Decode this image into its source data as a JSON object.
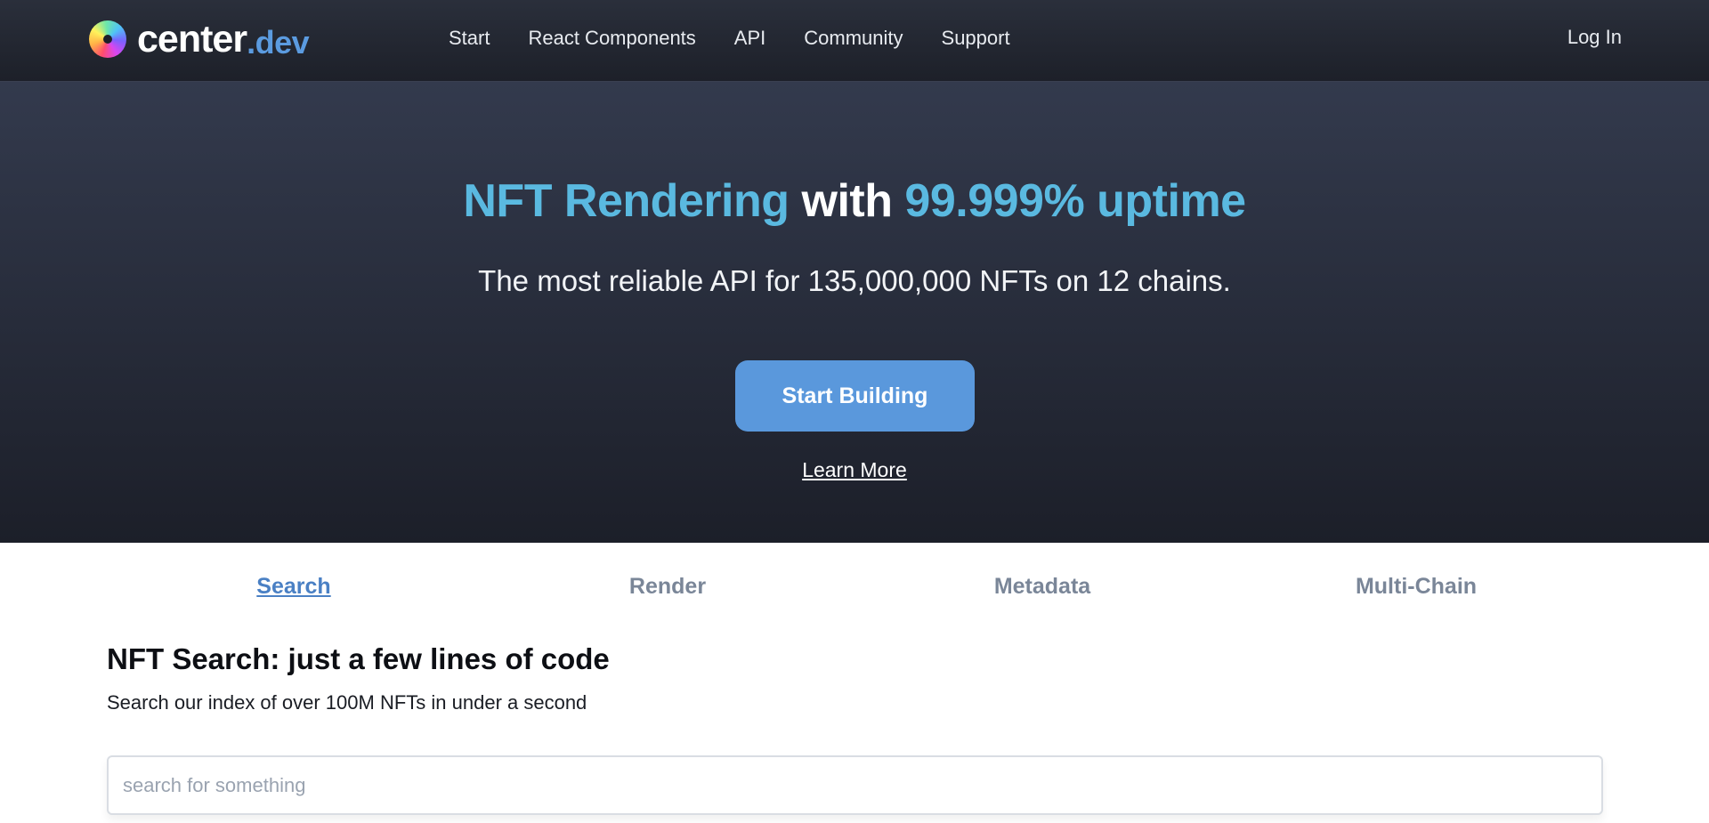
{
  "header": {
    "logo_word": "center",
    "logo_tld": ".dev",
    "nav": [
      {
        "label": "Start"
      },
      {
        "label": "React Components"
      },
      {
        "label": "API"
      },
      {
        "label": "Community"
      },
      {
        "label": "Support"
      }
    ],
    "login_label": "Log In"
  },
  "hero": {
    "title_part1": "NFT Rendering",
    "title_part2": " with ",
    "title_part3": "99.999% uptime",
    "subtitle": "The most reliable API for 135,000,000 NFTs on 12 chains.",
    "cta_label": "Start Building",
    "learn_more_label": "Learn More"
  },
  "tabs": [
    {
      "label": "Search",
      "active": true
    },
    {
      "label": "Render",
      "active": false
    },
    {
      "label": "Metadata",
      "active": false
    },
    {
      "label": "Multi-Chain",
      "active": false
    }
  ],
  "section": {
    "title": "NFT Search: just a few lines of code",
    "description": "Search our index of over 100M NFTs in under a second",
    "search_placeholder": "search for something",
    "search_value": ""
  },
  "colors": {
    "accent": "#5ab9e0",
    "button": "#5a98dc",
    "active_tab": "#4a80c4",
    "inactive_tab": "#7a8698"
  }
}
